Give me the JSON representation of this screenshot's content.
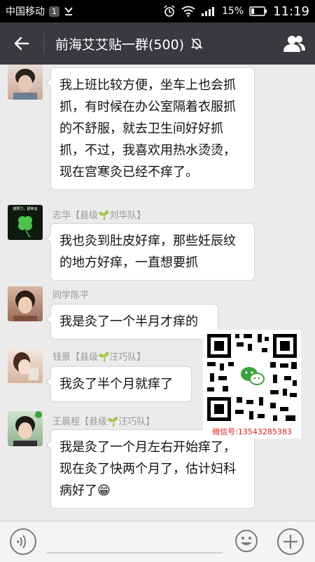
{
  "status_bar": {
    "carrier": "中国移动",
    "sim_slot": "1",
    "battery": "15%",
    "time": "11:19"
  },
  "header": {
    "title": "前海艾艾贴一群(500)",
    "back_icon": "arrow-left-icon",
    "mute_icon": "bell-off-icon",
    "group_icon": "people-icon"
  },
  "messages": [
    {
      "sender": "",
      "text": "我上班比较方便，坐车上也会抓抓，有时候在办公室隔着衣服抓的不舒服，就去卫生间好好抓抓，不过，我喜欢用热水烫烫，现在宫寒灸已经不痒了。"
    },
    {
      "sender": "志华【县级",
      "sender_team": "刘华队】",
      "text": "我也灸到肚皮好痒，那些妊辰纹的地方好痒，一直想要抓"
    },
    {
      "sender": "同学陈平",
      "sender_team": "",
      "text": "我是灸了一个半月才痒的"
    },
    {
      "sender": "钱景【县级",
      "sender_team": "汪巧队】",
      "text": "我灸了半个月就痒了"
    },
    {
      "sender": "王晨程【县级",
      "sender_team": "汪巧队】",
      "text": "我是灸了一个月左右开始痒了，现在灸了快两个月了，估计妇科病好了😁"
    }
  ],
  "avatar_caption": "越努力，越幸运",
  "qr_overlay": {
    "caption": "微信号:13543285383"
  },
  "input_bar": {
    "voice_icon": "voice-icon",
    "emoji_icon": "emoji-icon",
    "plus_icon": "plus-icon"
  },
  "colors": {
    "title_bar": "#393a3f",
    "chat_bg": "#ebebeb",
    "bubble": "#ffffff",
    "accent_green": "#3aa53a",
    "qr_caption": "#e02020"
  }
}
